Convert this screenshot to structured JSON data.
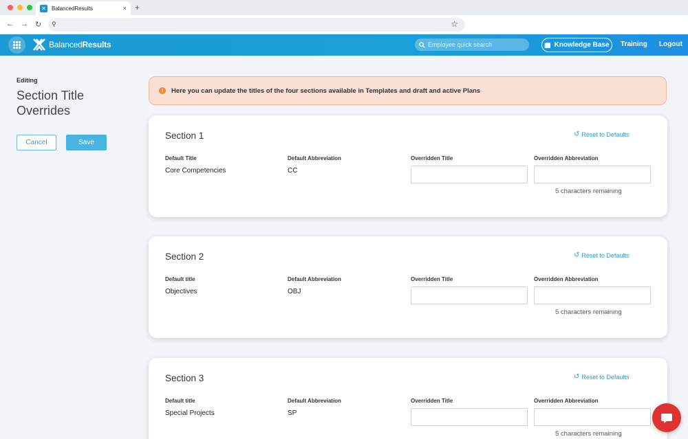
{
  "browser": {
    "tab_title": "BalancedResults",
    "tab_close": "×",
    "new_tab": "+",
    "back": "←",
    "forward": "→",
    "reload": "↻",
    "url_icon": "⚲",
    "bookmark": "☆"
  },
  "header": {
    "logo_regular": "Balanced",
    "logo_bold": "Results",
    "search_placeholder": "Employee quick search",
    "knowledge_base": "Knowledge Base",
    "training": "Training",
    "logout": "Logout"
  },
  "left": {
    "editing_label": "Editing",
    "title": "Section Title Overrides",
    "cancel": "Cancel",
    "save": "Save"
  },
  "notice": {
    "icon": "!",
    "text": "Here you can update the titles of the four sections available in Templates and draft and active Plans"
  },
  "sections": [
    {
      "title": "Section 1",
      "reset": "Reset to Defaults",
      "h_default_title": "Default Title",
      "h_default_abbr": "Default Abbreviation",
      "h_override_title": "Overridden Title",
      "h_override_abbr": "Overridden Abbreviation",
      "default_title": "Core Competencies",
      "default_abbr": "CC",
      "override_title": "",
      "override_abbr": "",
      "remaining": "5 characters remaining"
    },
    {
      "title": "Section 2",
      "reset": "Reset to Defaults",
      "h_default_title": "Default title",
      "h_default_abbr": "Default Abbreviation",
      "h_override_title": "Overridden Title",
      "h_override_abbr": "Overridden Abbreviation",
      "default_title": "Objectives",
      "default_abbr": "OBJ",
      "override_title": "",
      "override_abbr": "",
      "remaining": "5 characters remaining"
    },
    {
      "title": "Section 3",
      "reset": "Reset to Defaults",
      "h_default_title": "Default title",
      "h_default_abbr": "Default Abbreviation",
      "h_override_title": "Overridden Title",
      "h_override_abbr": "Overridden Abbreviation",
      "default_title": "Special Projects",
      "default_abbr": "SP",
      "override_title": "",
      "override_abbr": "",
      "remaining": "5 characters remaining"
    }
  ],
  "colors": {
    "brand": "#1b9ad6",
    "accent_link": "#2f97cf",
    "notice_bg": "#fae0d4",
    "chat": "#e03131"
  }
}
